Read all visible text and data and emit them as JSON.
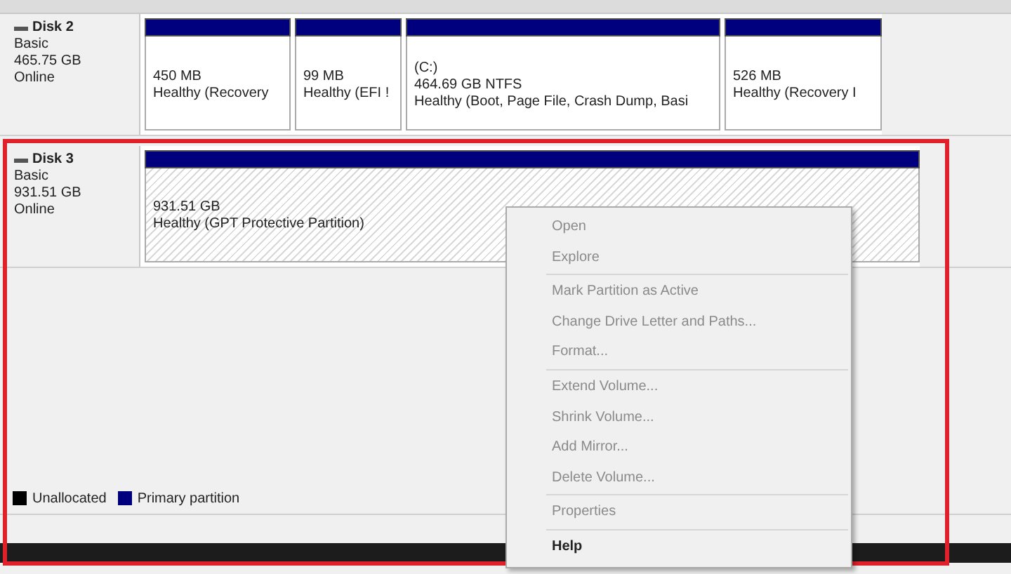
{
  "disks": [
    {
      "name": "Disk 2",
      "type": "Basic",
      "size": "465.75 GB",
      "status": "Online",
      "partitions": [
        {
          "kind": "primary",
          "lines": [
            "450 MB",
            "Healthy (Recovery"
          ]
        },
        {
          "kind": "primary",
          "lines": [
            "99 MB",
            "Healthy (EFI !"
          ]
        },
        {
          "kind": "primary",
          "lines": [
            "(C:)",
            "464.69 GB NTFS",
            "Healthy (Boot, Page File, Crash Dump, Basi"
          ]
        },
        {
          "kind": "primary",
          "lines": [
            "526 MB",
            "Healthy (Recovery I"
          ]
        }
      ]
    },
    {
      "name": "Disk 3",
      "type": "Basic",
      "size": "931.51 GB",
      "status": "Online",
      "partitions": [
        {
          "kind": "protective",
          "lines": [
            "931.51 GB",
            "Healthy (GPT Protective Partition)"
          ]
        }
      ]
    }
  ],
  "legend": [
    {
      "label": "Unallocated",
      "color": "#000000"
    },
    {
      "label": "Primary partition",
      "color": "#00007f"
    }
  ],
  "context_menu": {
    "groups": [
      [
        {
          "label": "Open",
          "disabled": true,
          "default": false
        },
        {
          "label": "Explore",
          "disabled": true,
          "default": false
        }
      ],
      [
        {
          "label": "Mark Partition as Active",
          "disabled": true,
          "default": false
        },
        {
          "label": "Change Drive Letter and Paths...",
          "disabled": true,
          "default": false
        },
        {
          "label": "Format...",
          "disabled": true,
          "default": false
        }
      ],
      [
        {
          "label": "Extend Volume...",
          "disabled": true,
          "default": false
        },
        {
          "label": "Shrink Volume...",
          "disabled": true,
          "default": false
        },
        {
          "label": "Add Mirror...",
          "disabled": true,
          "default": false
        },
        {
          "label": "Delete Volume...",
          "disabled": true,
          "default": false
        }
      ],
      [
        {
          "label": "Properties",
          "disabled": true,
          "default": false
        }
      ],
      [
        {
          "label": "Help",
          "disabled": false,
          "default": true
        }
      ]
    ]
  }
}
